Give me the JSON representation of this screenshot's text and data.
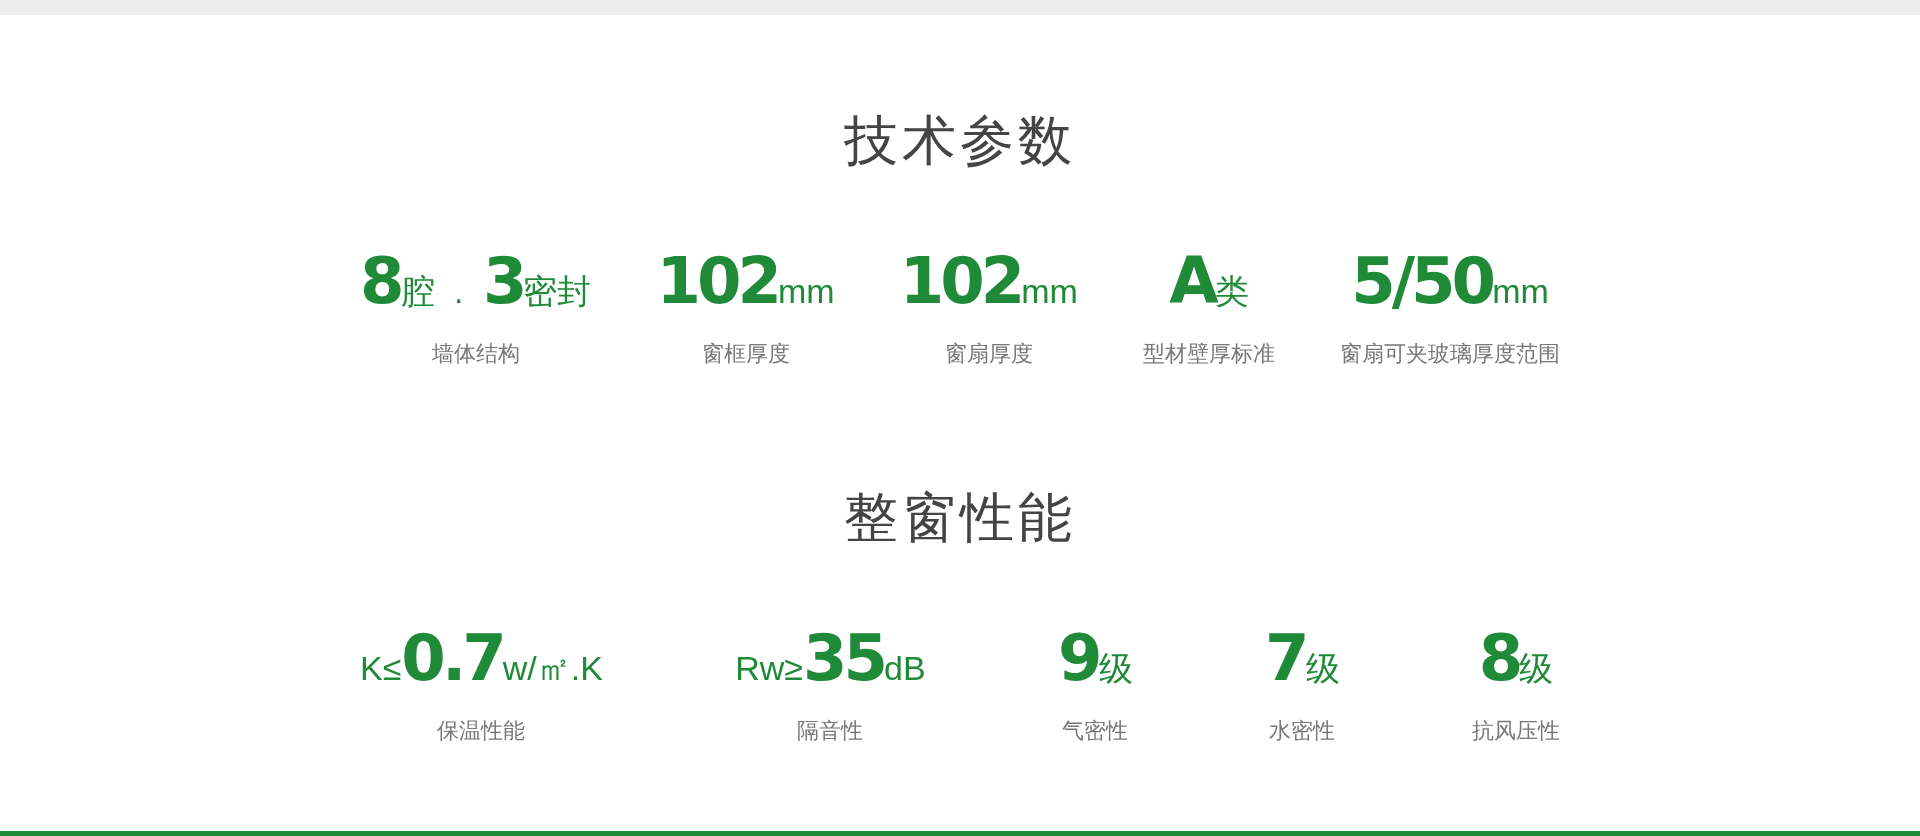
{
  "sections": [
    {
      "title": "技术参数",
      "items": [
        {
          "value": "**8**腔 . **3**密封",
          "label": "墙体结构"
        },
        {
          "value": "**102**mm",
          "label": "窗框厚度"
        },
        {
          "value": "**102**mm",
          "label": "窗扇厚度"
        },
        {
          "value": "**A**类",
          "label": "型材壁厚标准"
        },
        {
          "value": "**5/50**mm",
          "label": "窗扇可夹玻璃厚度范围"
        }
      ]
    },
    {
      "title": "整窗性能",
      "items": [
        {
          "value": "K≤**0.7**w/㎡.K",
          "label": "保温性能"
        },
        {
          "value": "Rw≥**35**dB",
          "label": "隔音性"
        },
        {
          "value": "**9**级",
          "label": "气密性"
        },
        {
          "value": "**7**级",
          "label": "水密性"
        },
        {
          "value": "**8**级",
          "label": "抗风压性"
        }
      ]
    }
  ]
}
